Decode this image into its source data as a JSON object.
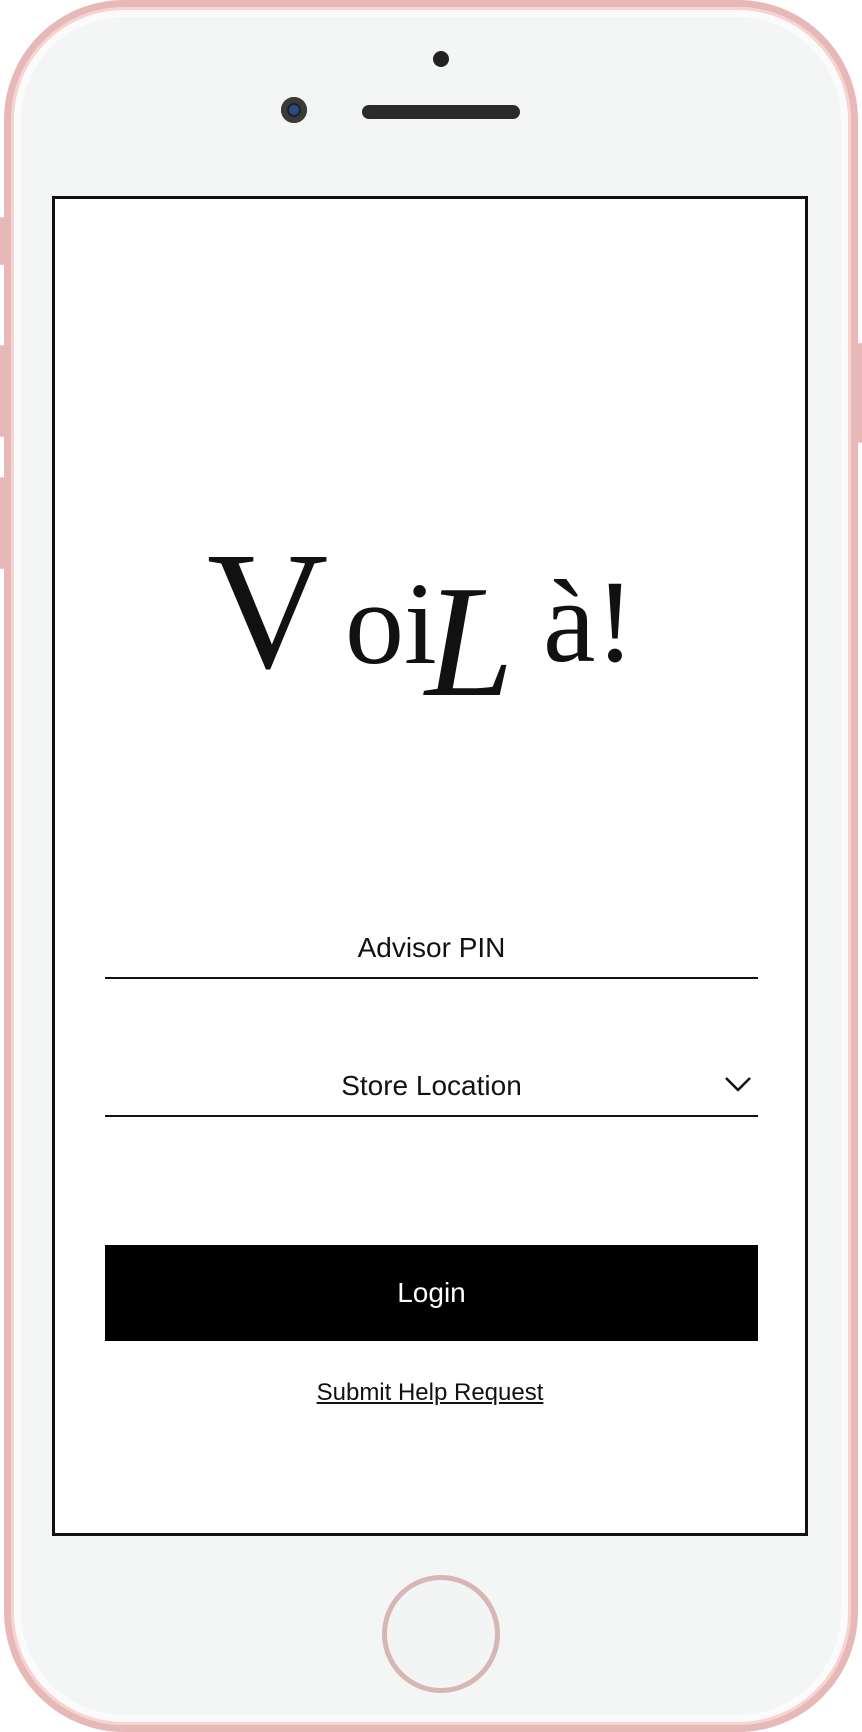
{
  "app": {
    "logo_text": "VoiLà!"
  },
  "form": {
    "pin_placeholder": "Advisor PIN",
    "store_placeholder": "Store Location",
    "login_label": "Login",
    "help_link": "Submit Help Request"
  },
  "colors": {
    "button_bg": "#000000",
    "button_text": "#ffffff",
    "frame": "#e6b9b8"
  },
  "icons": {
    "dropdown": "chevron-down-icon"
  }
}
